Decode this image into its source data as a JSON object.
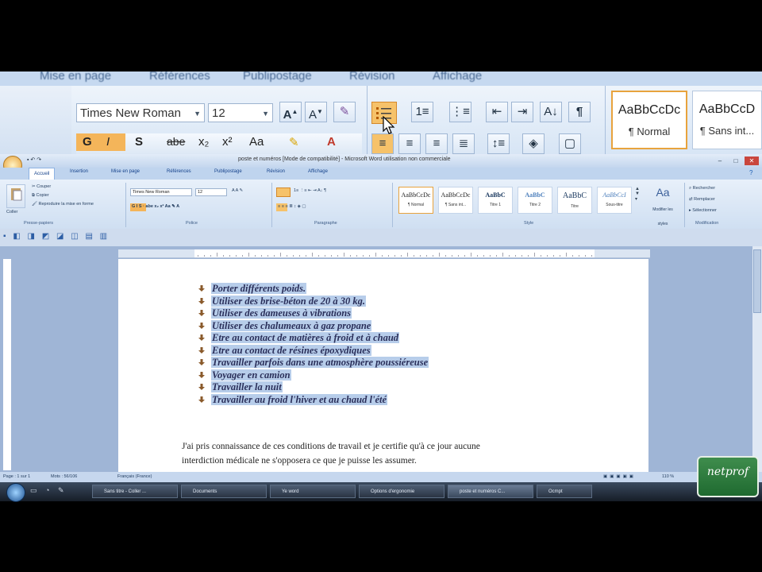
{
  "zoomed_ribbon": {
    "tabs": [
      "Mise en page",
      "Références",
      "Publipostage",
      "Révision",
      "Affichage"
    ],
    "font_name": "Times New Roman",
    "font_size": "12",
    "style_1": "AaBbCcDc",
    "style_1_name": "¶ Normal",
    "style_2": "AaBbCcD",
    "style_2_name": "¶ Sans int..."
  },
  "window": {
    "title": "poste et numéros [Mode de compatibilité] - Microsoft Word utilisation non commerciale",
    "tabs": [
      "Accueil",
      "Insertion",
      "Mise en page",
      "Références",
      "Publipostage",
      "Révision",
      "Affichage"
    ],
    "active_tab": "Accueil"
  },
  "ribbon": {
    "clipboard": {
      "paste": "Coller",
      "cut": "Couper",
      "copy": "Copier",
      "format_painter": "Reproduire la mise en forme",
      "label": "Presse-papiers"
    },
    "font": {
      "name": "Times New Roman",
      "size": "12",
      "label": "Police"
    },
    "paragraph": {
      "label": "Paragraphe"
    },
    "styles": {
      "label": "Style",
      "items": [
        {
          "preview": "AaBbCcDc",
          "name": "¶ Normal"
        },
        {
          "preview": "AaBbCcDc",
          "name": "¶ Sans int..."
        },
        {
          "preview": "AaBbC",
          "name": "Titre 1"
        },
        {
          "preview": "AaBbC",
          "name": "Titre 2"
        },
        {
          "preview": "AaBbC",
          "name": "Titre"
        },
        {
          "preview": "AaBbCcI",
          "name": "Sous-titre"
        }
      ],
      "change_styles": "Modifier les styles"
    },
    "editing": {
      "find": "Rechercher",
      "replace": "Remplacer",
      "select": "Sélectionner",
      "label": "Modification"
    }
  },
  "document": {
    "list_items": [
      "Porter différents poids.",
      "Utiliser des brise-béton de 20 à 30 kg.",
      "Utiliser des dameuses à vibrations",
      "Utiliser des chalumeaux à gaz propane",
      "Etre au contact de matières à froid et à chaud",
      "Etre au contact de résines époxydiques",
      "Travailler parfois dans une atmosphère poussiéreuse",
      "Voyager en camion",
      "Travailler la nuit",
      "Travailler au froid l'hiver et au chaud l'été"
    ],
    "paragraph_line_1": "J'ai pris connaissance de ces conditions de travail et je certifie qu'à ce jour aucune",
    "paragraph_line_2": "interdiction médicale ne s'opposera ce que je puisse les assumer."
  },
  "statusbar": {
    "page": "Page : 1 sur 1",
    "words": "Mots : 56/106",
    "language": "Français (France)",
    "zoom": "110 %"
  },
  "taskbar": {
    "buttons": [
      "Sans titre - Coller ...",
      "Documents",
      "Ye word",
      "Options d'ergonomie",
      "poste et numéros C...",
      "Ocmpt"
    ]
  },
  "watermark": {
    "text": "netprof"
  },
  "colors": {
    "selection": "#b7cdea",
    "ribbon": "#d5e3f4",
    "workspace": "#9fb5d6",
    "taskbar": "#1e2733",
    "watermark": "#2f7d3e"
  }
}
